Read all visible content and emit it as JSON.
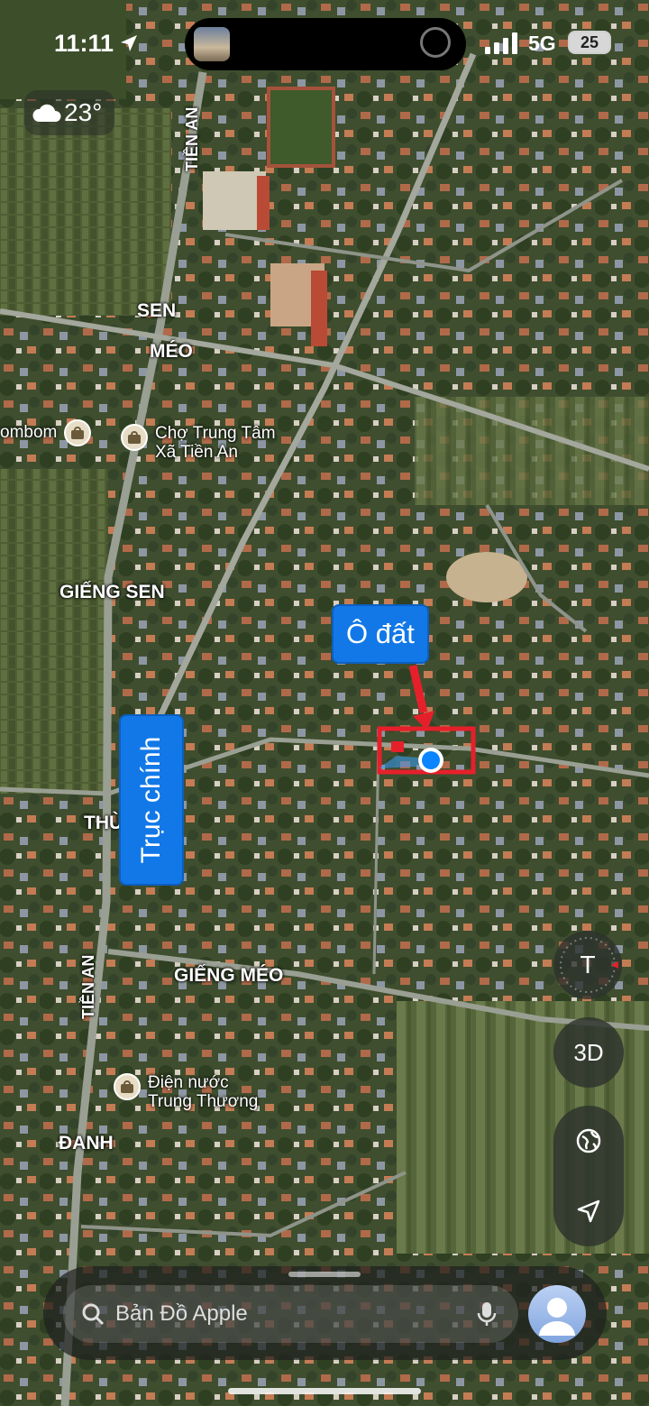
{
  "status_bar": {
    "time": "11:11",
    "network": "5G",
    "battery": "25"
  },
  "weather": {
    "temperature": "23°",
    "icon": "cloud-icon"
  },
  "map": {
    "road_labels": {
      "tien_an_top": "TIỀN AN",
      "tien_an_bottom": "TIỀN AN"
    },
    "place_labels": {
      "sen": "SEN",
      "meo": "MÉO",
      "gieng_sen": "GIẾNG SEN",
      "thu": "THÙ",
      "gieng_meo": "GIẾNG MÉO",
      "danh": "ĐANH"
    },
    "pois": {
      "combom": {
        "label": "ombom",
        "icon": "shopping-bag-icon"
      },
      "cho": {
        "line1": "Chợ Trung Tâm",
        "line2": "Xã Tiền An",
        "icon": "shopping-bag-icon"
      },
      "dien_nuoc": {
        "line1": "Điện nước",
        "line2": "Trung Thương",
        "icon": "shopping-bag-icon"
      }
    }
  },
  "annotations": {
    "lot_label": "Ô đất",
    "main_road_label": "Trục chính",
    "highlight_color": "#e5202b",
    "label_color": "#1278e8"
  },
  "controls": {
    "compass_letter": "T",
    "view_3d": "3D",
    "globe_icon": "globe-icon",
    "location_icon": "location-arrow-icon"
  },
  "search": {
    "placeholder": "Bản Đồ Apple",
    "mic_icon": "microphone-icon",
    "search_icon": "search-icon"
  }
}
